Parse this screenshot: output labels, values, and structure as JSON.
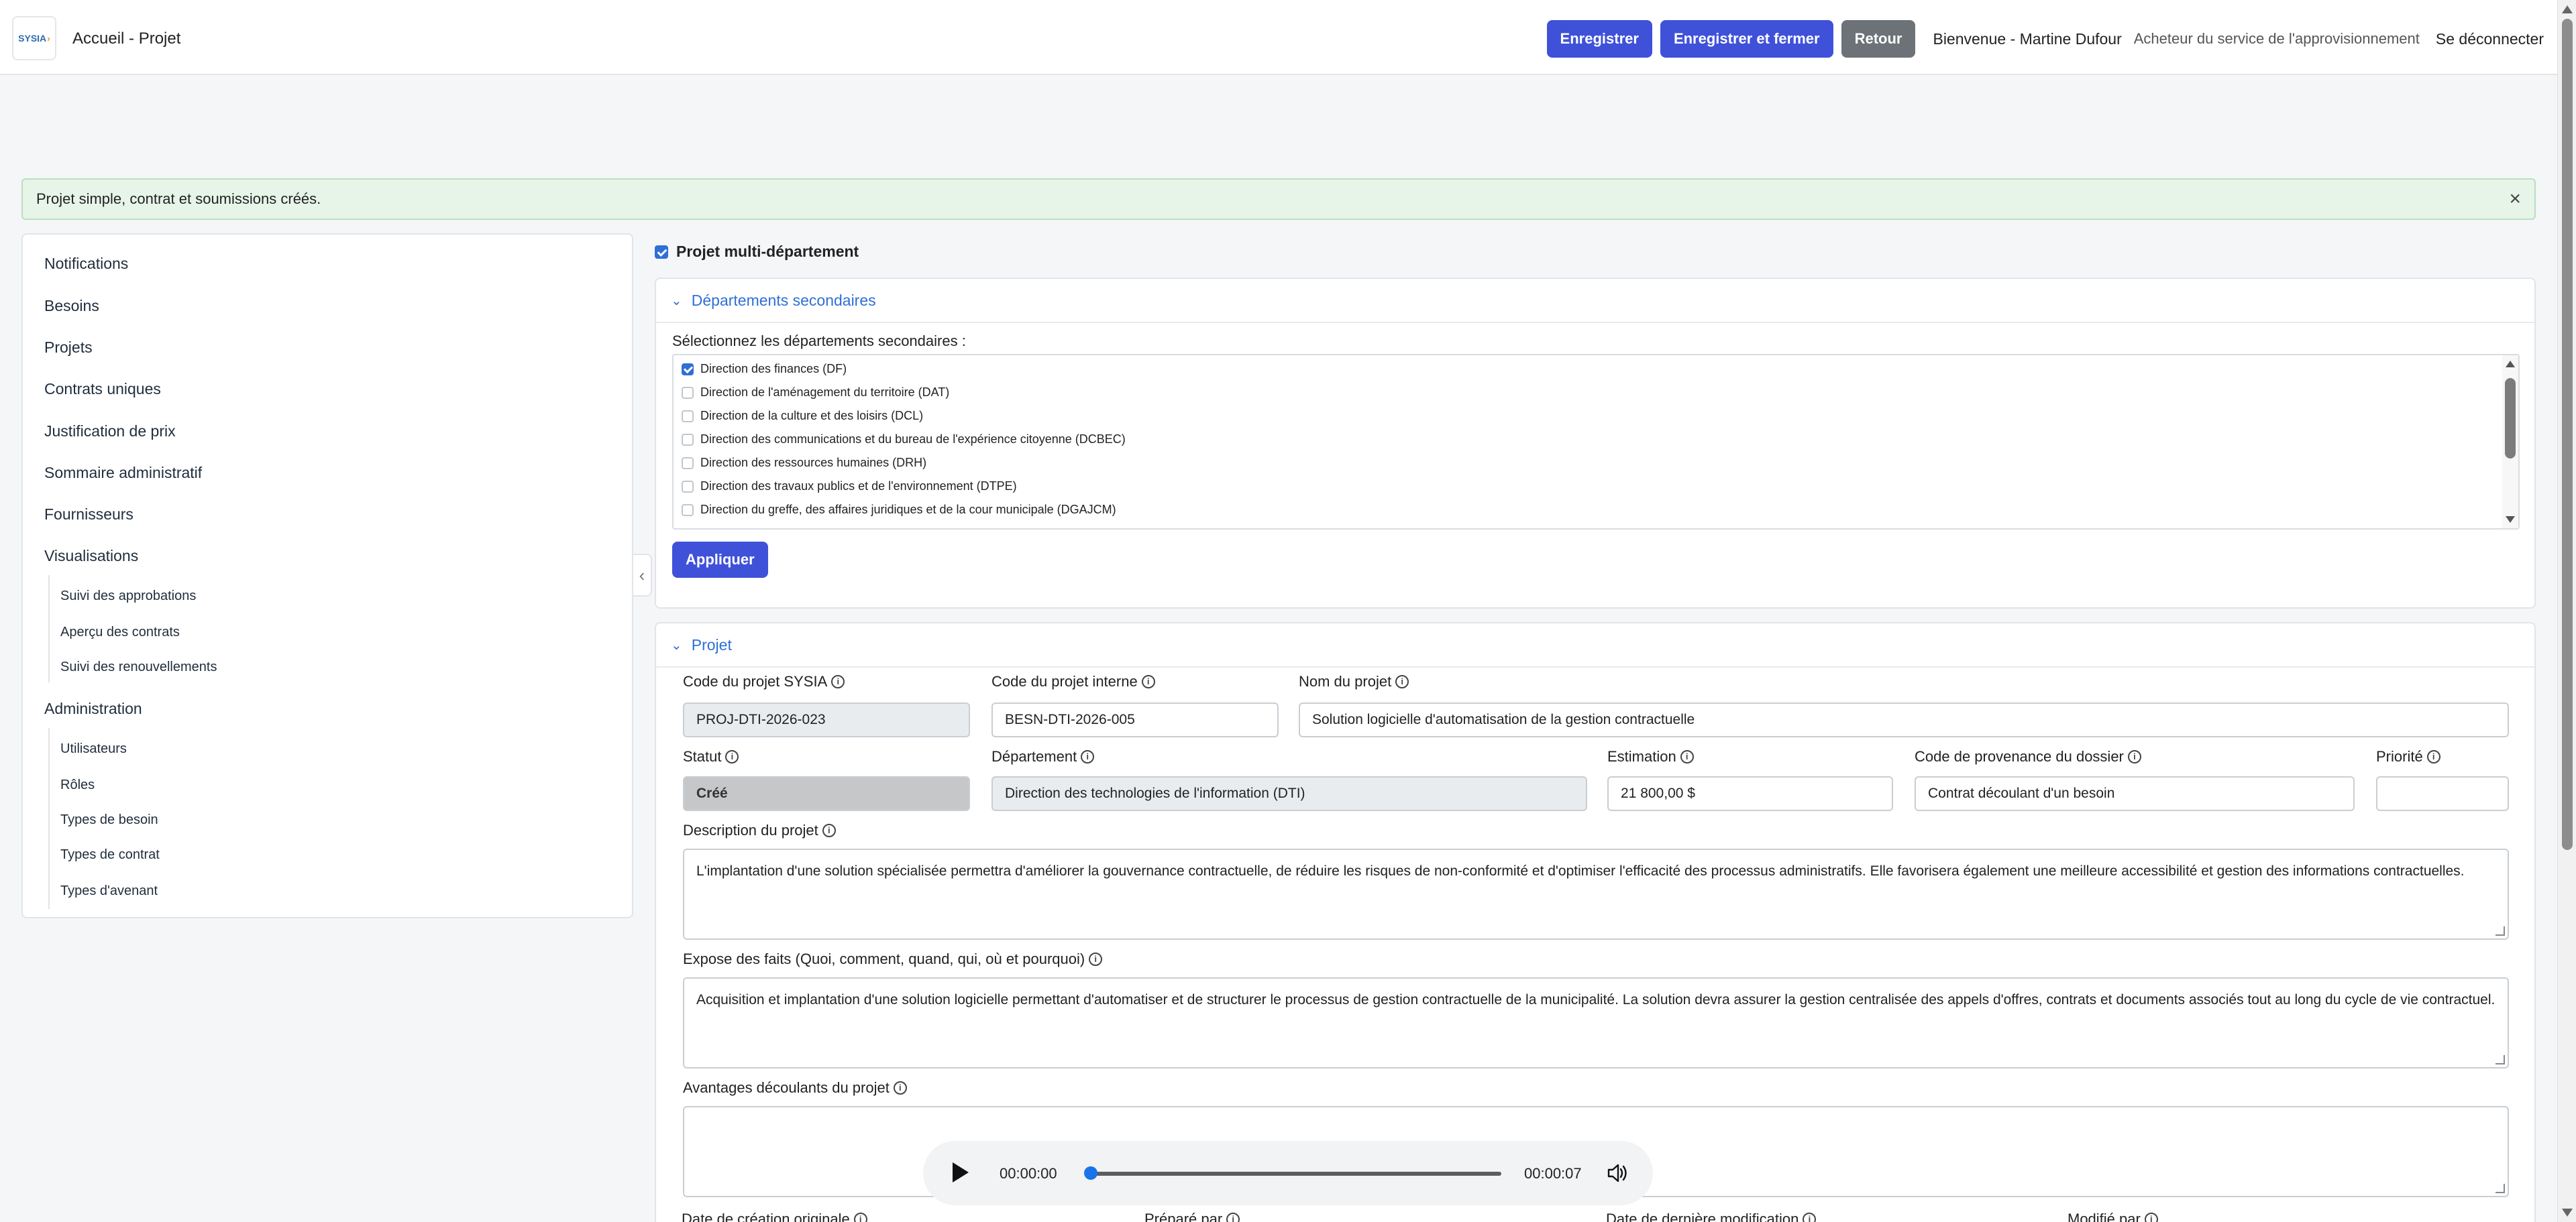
{
  "header": {
    "logo_text": "SYSIA",
    "breadcrumb": "Accueil - Projet",
    "buttons": {
      "save": "Enregistrer",
      "save_close": "Enregistrer et fermer",
      "back": "Retour"
    },
    "welcome": "Bienvenue - Martine Dufour",
    "role": "Acheteur du service de l'approvisionnement",
    "logout": "Se déconnecter"
  },
  "alert": {
    "message": "Projet simple, contrat et soumissions créés.",
    "close_icon": "×"
  },
  "sidebar": {
    "items": {
      "notifications": "Notifications",
      "besoins": "Besoins",
      "projets": "Projets",
      "contrats": "Contrats uniques",
      "justification": "Justification de prix",
      "sommaire": "Sommaire administratif",
      "fournisseurs": "Fournisseurs",
      "visualisations": "Visualisations",
      "administration": "Administration"
    },
    "visualisations_sub": [
      "Suivi des approbations",
      "Aperçu des contrats",
      "Suivi des renouvellements"
    ],
    "administration_sub": [
      "Utilisateurs",
      "Rôles",
      "Types de besoin",
      "Types de contrat",
      "Types d'avenant"
    ]
  },
  "multi_department": {
    "label": "Projet multi-département",
    "checked": true
  },
  "secondary_departments": {
    "title": "Départements secondaires",
    "select_label": "Sélectionnez les départements secondaires :",
    "items": [
      {
        "label": "Direction des finances (DF)",
        "checked": true
      },
      {
        "label": "Direction de l'aménagement du territoire (DAT)",
        "checked": false
      },
      {
        "label": "Direction de la culture et des loisirs (DCL)",
        "checked": false
      },
      {
        "label": "Direction des communications et du bureau de l'expérience citoyenne (DCBEC)",
        "checked": false
      },
      {
        "label": "Direction des ressources humaines (DRH)",
        "checked": false
      },
      {
        "label": "Direction des travaux publics et de l'environnement (DTPE)",
        "checked": false
      },
      {
        "label": "Direction du greffe, des affaires juridiques et de la cour municipale (DGAJCM)",
        "checked": false
      }
    ],
    "apply_button": "Appliquer"
  },
  "project": {
    "title": "Projet",
    "labels": {
      "code_sysia": "Code du projet SYSIA",
      "code_interne": "Code du projet interne",
      "nom": "Nom du projet",
      "statut": "Statut",
      "departement": "Département",
      "estimation": "Estimation",
      "provenance": "Code de provenance du dossier",
      "priorite": "Priorité",
      "description": "Description du projet",
      "expose": "Expose des faits (Quoi, comment, quand, qui, où et pourquoi)",
      "avantages": "Avantages découlants du projet",
      "date_creation": "Date de création originale",
      "prepare_par": "Préparé par",
      "date_modif": "Date de dernière modification",
      "modifie_par": "Modifié par"
    },
    "values": {
      "code_sysia": "PROJ-DTI-2026-023",
      "code_interne": "BESN-DTI-2026-005",
      "nom": "Solution logicielle d'automatisation de la gestion contractuelle",
      "statut": "Créé",
      "departement": "Direction des technologies de l'information (DTI)",
      "estimation": "21 800,00 $",
      "provenance": "Contrat découlant d'un besoin",
      "priorite": "",
      "description": "L'implantation d'une solution spécialisée permettra d'améliorer la gouvernance contractuelle, de réduire les risques de non-conformité et d'optimiser l'efficacité des processus administratifs. Elle favorisera également une meilleure accessibilité et gestion des informations contractuelles.",
      "expose": "Acquisition et implantation d'une solution logicielle permettant d'automatiser et de structurer le processus de gestion contractuelle de la municipalité. La solution devra assurer la gestion centralisée des appels d'offres, contrats et documents associés tout au long du cycle de vie contractuel.",
      "avantages": ""
    }
  },
  "audio_player": {
    "current_time": "00:00:00",
    "duration": "00:00:07",
    "progress": 0
  },
  "icons": {
    "info": "info-circle-icon",
    "chevron": "chevron-down-icon",
    "collapse": "chevron-left-icon",
    "play": "play-icon",
    "volume": "volume-icon"
  },
  "colors": {
    "primary": "#3f51d9",
    "link": "#2f6fd6",
    "success_bg": "#e7f5e9"
  }
}
